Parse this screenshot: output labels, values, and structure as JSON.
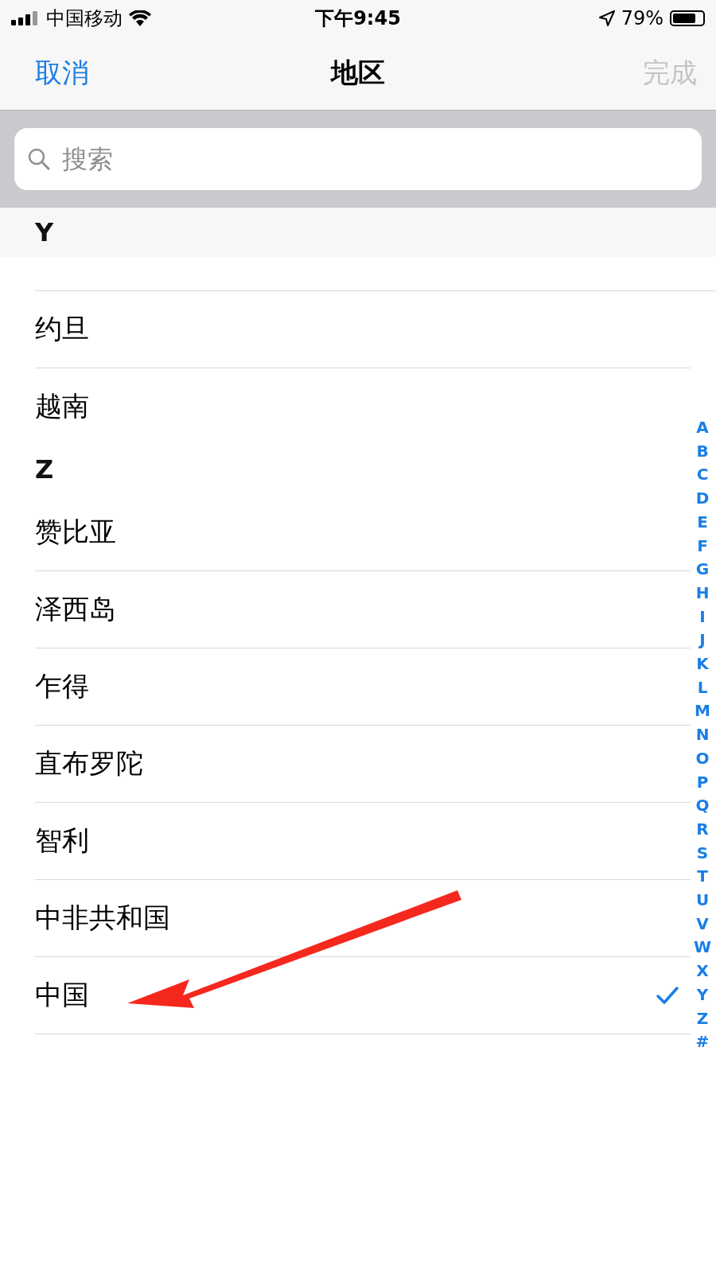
{
  "status_bar": {
    "carrier": "中国移动",
    "time": "下午9:45",
    "battery_text": "79%",
    "battery": {
      "level": 0.79
    }
  },
  "nav": {
    "cancel": "取消",
    "title": "地区",
    "done": "完成",
    "done_disabled": true
  },
  "search": {
    "placeholder": "搜索"
  },
  "sections": [
    {
      "letter": "Y",
      "sticky": true,
      "rows": [
        {
          "name": "约旦",
          "selected": false
        },
        {
          "name": "越南",
          "selected": false
        }
      ]
    },
    {
      "letter": "Z",
      "sticky": false,
      "rows": [
        {
          "name": "赞比亚",
          "selected": false
        },
        {
          "name": "泽西岛",
          "selected": false
        },
        {
          "name": "乍得",
          "selected": false
        },
        {
          "name": "直布罗陀",
          "selected": false
        },
        {
          "name": "智利",
          "selected": false
        },
        {
          "name": "中非共和国",
          "selected": false
        },
        {
          "name": "中国",
          "selected": true
        }
      ]
    }
  ],
  "index": [
    "A",
    "B",
    "C",
    "D",
    "E",
    "F",
    "G",
    "H",
    "I",
    "J",
    "K",
    "L",
    "M",
    "N",
    "O",
    "P",
    "Q",
    "R",
    "S",
    "T",
    "U",
    "V",
    "W",
    "X",
    "Y",
    "Z",
    "#"
  ]
}
